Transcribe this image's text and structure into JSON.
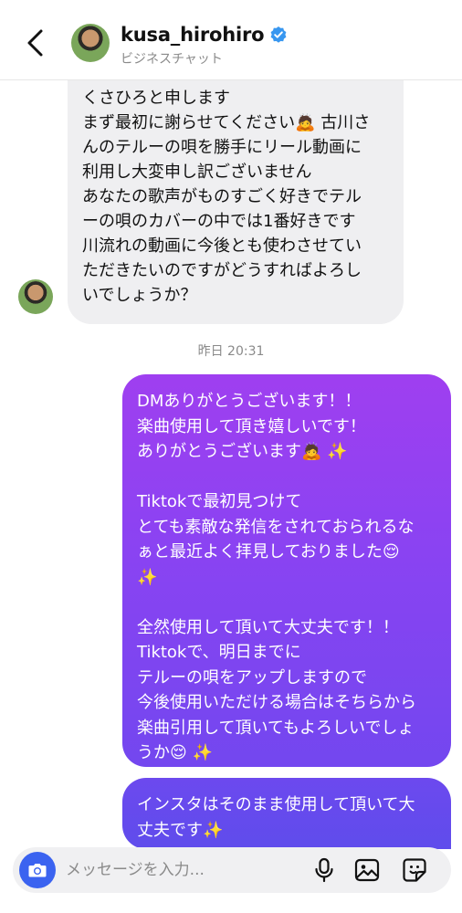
{
  "header": {
    "username": "kusa_hirohiro",
    "subtitle": "ビジネスチャット",
    "verified": true,
    "accent_color": "#3897f0"
  },
  "incoming_message": {
    "lines": [
      "くさひろと申します",
      "まず最初に謝らせてください🙇 古川さ",
      "んのテルーの唄を勝手にリール動画に",
      "利用し大変申し訳ございません",
      "あなたの歌声がものすごく好きでテル",
      "ーの唄のカバーの中では1番好きです",
      "川流れの動画に今後とも使わさせてい",
      "ただきたいのですがどうすればよろし",
      "いでしょうか？"
    ]
  },
  "timestamp": "昨日 20:31",
  "outgoing_messages": [
    {
      "lines": [
        "DMありがとうございます！！",
        "楽曲使用して頂き嬉しいです！",
        "ありがとうございます🙇 ✨",
        "",
        "Tiktokで最初見つけて",
        "とても素敵な発信をされておられるな",
        "ぁと最近よく拝見しておりました😌",
        "✨",
        "",
        "全然使用して頂いて大丈夫です！！",
        "Tiktokで、明日までに",
        "テルーの唄をアップしますので",
        "今後使用いただける場合はそちらから",
        "楽曲引用して頂いてもよろしいでしょ",
        "うか😌 ✨"
      ]
    },
    {
      "lines": [
        "インスタはそのまま使用して頂いて大",
        "丈夫です✨"
      ]
    }
  ],
  "composer": {
    "placeholder": "メッセージを入力...",
    "value": ""
  },
  "icons": {
    "back": "chevron-left-icon",
    "camera": "camera-icon",
    "mic": "microphone-icon",
    "gallery": "image-icon",
    "sticker": "sticker-icon"
  },
  "colors": {
    "bubble_out_top": "#9f3ff0",
    "bubble_out_bottom": "#5f4cec",
    "bubble_in": "#efeff1",
    "camera_button": "#3b63f0"
  }
}
